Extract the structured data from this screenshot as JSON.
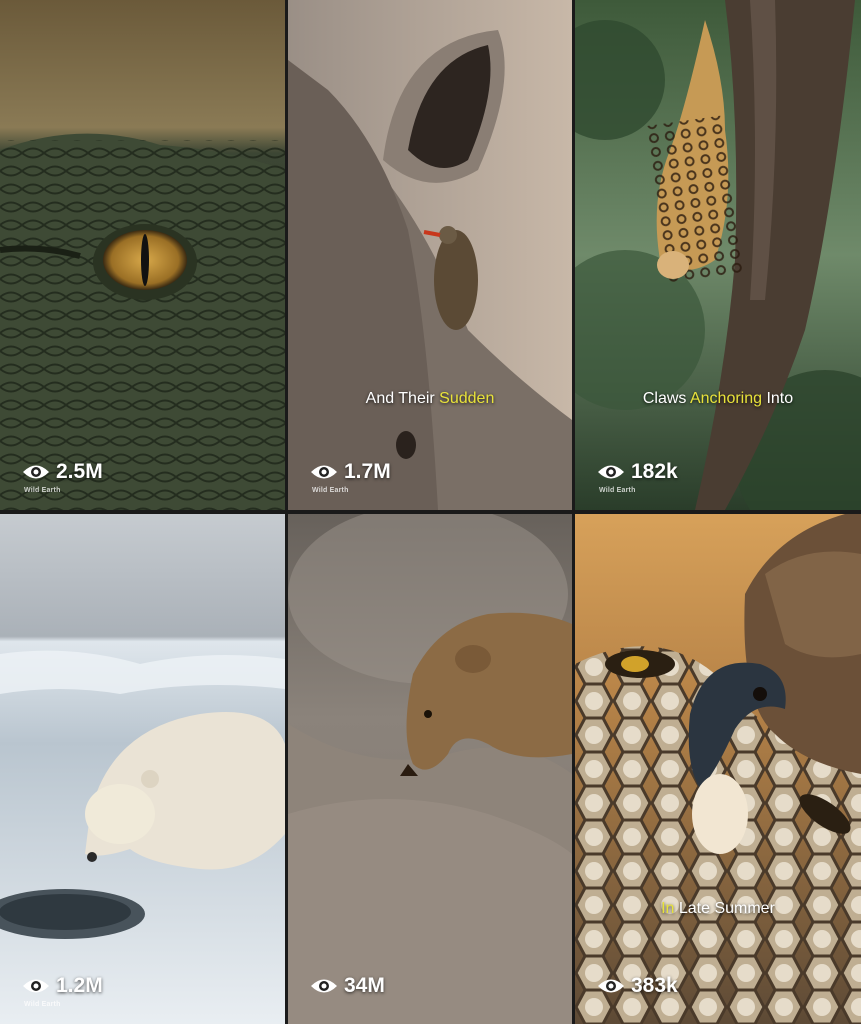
{
  "colors": {
    "caption_highlight": "#e8e23a",
    "caption_text": "#ffffff",
    "views_text": "#ffffff",
    "grid_gap": "#1a1a1a"
  },
  "tiles": [
    {
      "subject": "crocodile-eye",
      "views": "2.5M",
      "watermark": "Wild Earth",
      "caption": null
    },
    {
      "subject": "rhino-with-oxpecker",
      "views": "1.7M",
      "watermark": "Wild Earth",
      "caption": {
        "plain": "And Their ",
        "highlight": "Sudden"
      }
    },
    {
      "subject": "clouded-leopard-in-tree",
      "views": "182k",
      "watermark": "Wild Earth",
      "caption": {
        "plain": "Claws ",
        "highlight": "Anchoring",
        "tail": " Into"
      }
    },
    {
      "subject": "polar-bear-on-ice",
      "views": "1.2M",
      "watermark": "Wild Earth",
      "caption": null
    },
    {
      "subject": "mongoose-feeding",
      "views": "34M",
      "watermark": "",
      "caption": null
    },
    {
      "subject": "eagle-eating-wasp-larvae",
      "views": "383k",
      "watermark": "",
      "caption": {
        "highlight": "In",
        "plain": " Late Summer"
      }
    }
  ]
}
